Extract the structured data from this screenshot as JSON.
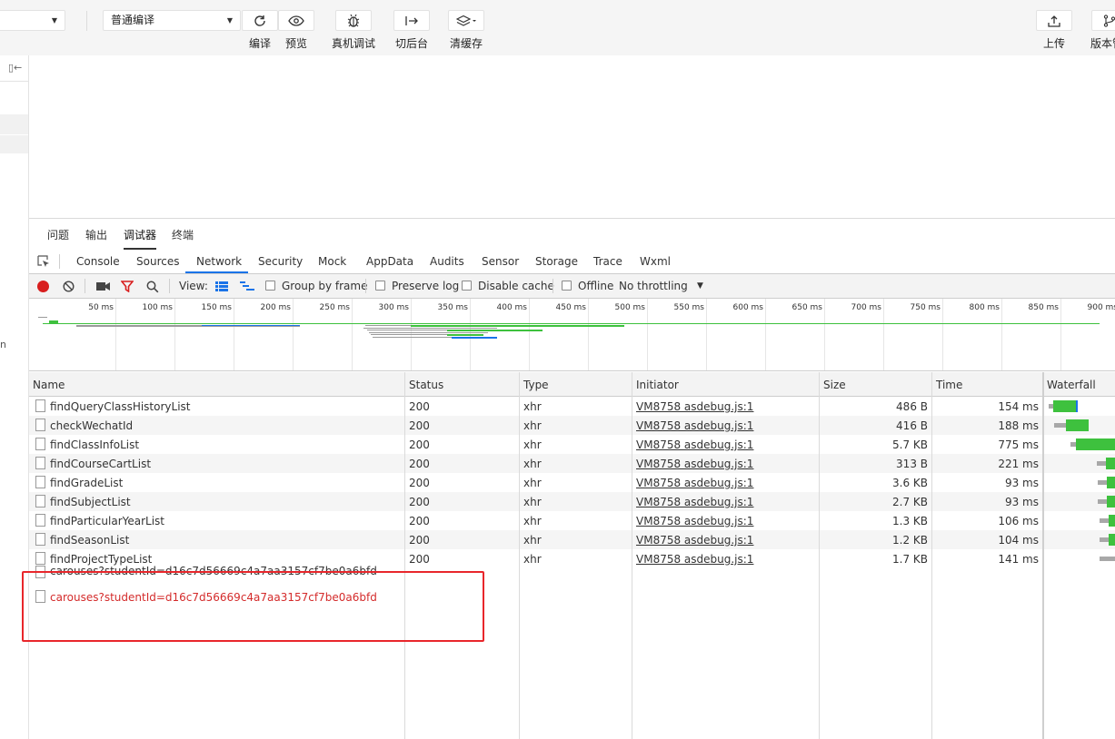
{
  "toolbar": {
    "mode_value": "普通编译",
    "buttons": [
      {
        "icon": "refresh-icon",
        "label": "编译"
      },
      {
        "icon": "eye-icon",
        "label": "预览"
      },
      {
        "icon": "bug-icon",
        "label": "真机调试"
      },
      {
        "icon": "switch-backend-icon",
        "label": "切后台"
      },
      {
        "icon": "layers-icon",
        "label": "清缓存"
      },
      {
        "icon": "upload-icon",
        "label": "上传"
      },
      {
        "icon": "branch-icon",
        "label": "版本管"
      }
    ]
  },
  "left_strip": {
    "partial_text": "n"
  },
  "panel_tabs": [
    "问题",
    "输出",
    "调试器",
    "终端"
  ],
  "devtools_tabs": [
    "Console",
    "Sources",
    "Network",
    "Security",
    "Mock",
    "AppData",
    "Audits",
    "Sensor",
    "Storage",
    "Trace",
    "Wxml"
  ],
  "network_toolbar": {
    "view_label": "View:",
    "group_by_frame": "Group by frame",
    "preserve_log": "Preserve log",
    "disable_cache": "Disable cache",
    "offline": "Offline",
    "throttling": "No throttling"
  },
  "overview": {
    "ticks": [
      "50 ms",
      "100 ms",
      "150 ms",
      "200 ms",
      "250 ms",
      "300 ms",
      "350 ms",
      "400 ms",
      "450 ms",
      "500 ms",
      "550 ms",
      "600 ms",
      "650 ms",
      "700 ms",
      "750 ms",
      "800 ms",
      "850 ms",
      "900 ms"
    ]
  },
  "table": {
    "headers": {
      "name": "Name",
      "status": "Status",
      "type": "Type",
      "initiator": "Initiator",
      "size": "Size",
      "time": "Time",
      "waterfall": "Waterfall"
    },
    "rows": [
      {
        "name": "findQueryClassHistoryList",
        "status": "200",
        "type": "xhr",
        "initiator": "VM8758 asdebug.js:1",
        "size": "486 B",
        "time": "154 ms"
      },
      {
        "name": "checkWechatId",
        "status": "200",
        "type": "xhr",
        "initiator": "VM8758 asdebug.js:1",
        "size": "416 B",
        "time": "188 ms"
      },
      {
        "name": "findClassInfoList",
        "status": "200",
        "type": "xhr",
        "initiator": "VM8758 asdebug.js:1",
        "size": "5.7 KB",
        "time": "775 ms"
      },
      {
        "name": "findCourseCartList",
        "status": "200",
        "type": "xhr",
        "initiator": "VM8758 asdebug.js:1",
        "size": "313 B",
        "time": "221 ms"
      },
      {
        "name": "findGradeList",
        "status": "200",
        "type": "xhr",
        "initiator": "VM8758 asdebug.js:1",
        "size": "3.6 KB",
        "time": "93 ms"
      },
      {
        "name": "findSubjectList",
        "status": "200",
        "type": "xhr",
        "initiator": "VM8758 asdebug.js:1",
        "size": "2.7 KB",
        "time": "93 ms"
      },
      {
        "name": "findParticularYearList",
        "status": "200",
        "type": "xhr",
        "initiator": "VM8758 asdebug.js:1",
        "size": "1.3 KB",
        "time": "106 ms"
      },
      {
        "name": "findSeasonList",
        "status": "200",
        "type": "xhr",
        "initiator": "VM8758 asdebug.js:1",
        "size": "1.2 KB",
        "time": "104 ms"
      },
      {
        "name": "findProjectTypeList",
        "status": "200",
        "type": "xhr",
        "initiator": "VM8758 asdebug.js:1",
        "size": "1.7 KB",
        "time": "141 ms"
      }
    ],
    "pending_rows": [
      {
        "name": "carouses?studentId=d16c7d56669c4a7aa3157cf7be0a6bfd",
        "color": "#333333"
      },
      {
        "name": "carouses?studentId=d16c7d56669c4a7aa3157cf7be0a6bfd",
        "color": "#d42b2b"
      }
    ]
  },
  "colors": {
    "accent_blue": "#1a73e8",
    "waterfall_green": "#3ec13e",
    "record_red": "#d81e1e",
    "highlight_red": "#e8262b"
  }
}
